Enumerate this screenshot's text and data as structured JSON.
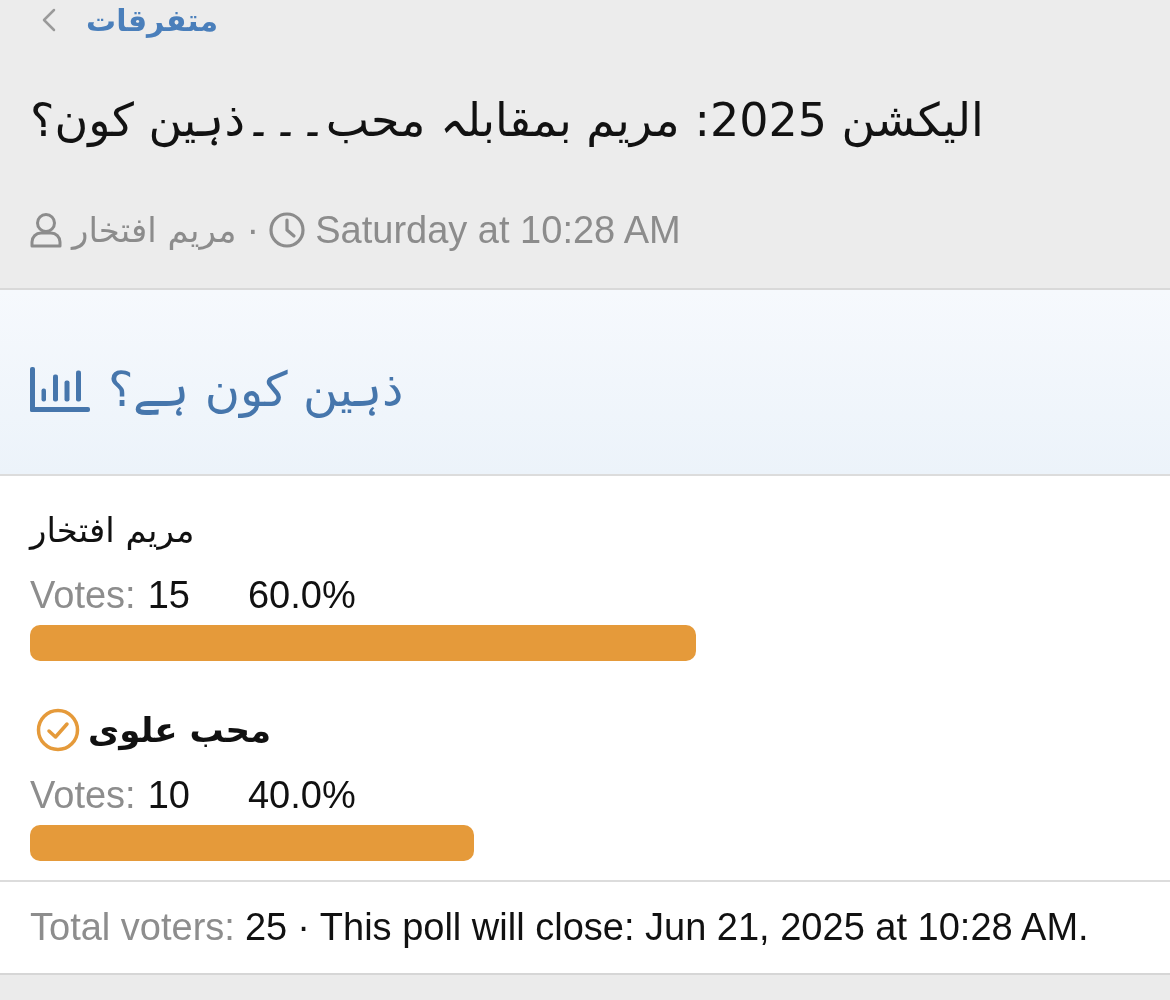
{
  "breadcrumb": {
    "label": "متفرقات"
  },
  "thread": {
    "title": "الیکشن 2025: مریم بمقابلہ محب۔۔۔ذہین کون؟",
    "author": "مریم افتخار",
    "separator": "·",
    "date": "Saturday at 10:28 AM"
  },
  "poll": {
    "title": "ذہین کون ہے؟",
    "options": [
      {
        "name": "مریم افتخار",
        "voted": false,
        "votes_label": "Votes:",
        "votes": "15",
        "percent": "60.0%",
        "level": 0.6
      },
      {
        "name": "محب علوی",
        "voted": true,
        "votes_label": "Votes:",
        "votes": "10",
        "percent": "40.0%",
        "level": 0.4
      }
    ],
    "footer": {
      "total_label": "Total voters:",
      "total": "25",
      "separator": "·",
      "close_text": "This poll will close: Jun 21, 2025 at 10:28 AM."
    }
  }
}
